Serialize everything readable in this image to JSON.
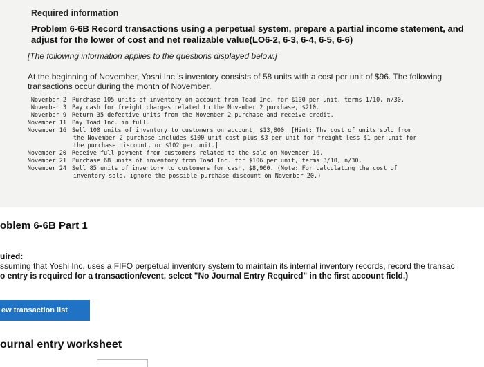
{
  "header": {
    "required_info": "Required information",
    "problem_title": "Problem 6-6B Record transactions using a perpetual system, prepare a partial income statement, and adjust for the lower of cost and net realizable value(LO6-2, 6-3, 6-4, 6-5, 6-6)",
    "info_note": "[The following information applies to the questions displayed below.]",
    "intro": "At the beginning of November, Yoshi Inc.'s inventory consists of 58 units with a cost per unit of $96. The following transactions occur during the month of November."
  },
  "transactions": [
    {
      "date": "November  2",
      "lines": [
        "Purchase 105 units of inventory on account from Toad Inc. for $100 per unit, terms 1/10, n/30."
      ]
    },
    {
      "date": "November  3",
      "lines": [
        "Pay cash for freight charges related to the November 2 purchase, $210."
      ]
    },
    {
      "date": "November  9",
      "lines": [
        "Return 35 defective units from the November 2 purchase and receive credit."
      ]
    },
    {
      "date": "November 11",
      "lines": [
        "Pay Toad Inc. in full."
      ]
    },
    {
      "date": "November 16",
      "lines": [
        "Sell 100 units of inventory to customers on account, $13,800. [Hint: The cost of units sold from",
        "the November 2 purchase includes $100 unit cost plus $3 per unit for freight less $1 per unit for",
        "the purchase discount, or $102 per unit.]"
      ]
    },
    {
      "date": "November 20",
      "lines": [
        "Receive full payment from customers related to the sale on November 16."
      ]
    },
    {
      "date": "November 21",
      "lines": [
        "Purchase 68 units of inventory from Toad Inc. for $106 per unit, terms 3/10, n/30."
      ]
    },
    {
      "date": "November 24",
      "lines": [
        "Sell 85 units of inventory to customers for cash, $8,900. (Note: For calculating the cost of",
        "inventory sold, ignore the possible purchase discount on November 20.)"
      ]
    }
  ],
  "part": {
    "title": "oblem 6-6B Part 1",
    "req_label": "uired:",
    "req_line1": "ssuming that Yoshi Inc. uses a FIFO perpetual inventory system to maintain its internal inventory records, record the transac",
    "req_line2": "o entry is required for a transaction/event, select \"No Journal Entry Required\" in the first account field.)"
  },
  "buttons": {
    "view_transaction_list": "ew transaction list"
  },
  "worksheet": {
    "title": "ournal entry worksheet"
  }
}
